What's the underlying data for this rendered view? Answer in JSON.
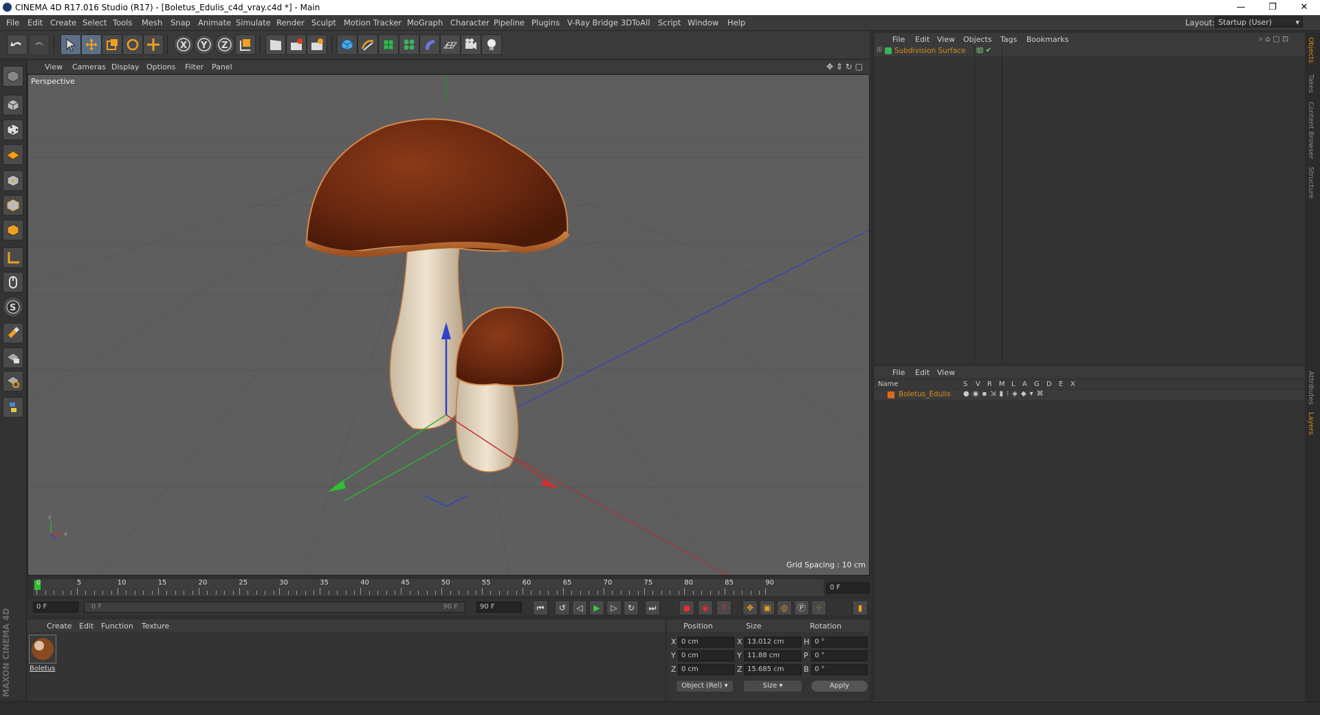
{
  "window": {
    "title": "CINEMA 4D R17.016 Studio (R17) - [Boletus_Edulis_c4d_vray.c4d *] - Main",
    "controls": [
      "—",
      "❐",
      "✕"
    ]
  },
  "menubar": {
    "items": [
      "File",
      "Edit",
      "Create",
      "Select",
      "Tools",
      "Mesh",
      "Snap",
      "Animate",
      "Simulate",
      "Render",
      "Sculpt",
      "Motion Tracker",
      "MoGraph",
      "Character",
      "Pipeline",
      "Plugins",
      "V-Ray Bridge",
      "3DToAll",
      "Script",
      "Window",
      "Help"
    ],
    "layout_label": "Layout:",
    "layout_value": "Startup (User)"
  },
  "viewport": {
    "menu": [
      "View",
      "Cameras",
      "Display",
      "Options",
      "Filter",
      "Panel"
    ],
    "camera_label": "Perspective",
    "grid_spacing": "Grid Spacing : 10 cm"
  },
  "timeline": {
    "ticks": [
      "0",
      "5",
      "10",
      "15",
      "20",
      "25",
      "30",
      "35",
      "40",
      "45",
      "50",
      "55",
      "60",
      "65",
      "70",
      "75",
      "80",
      "85",
      "90"
    ],
    "current_frame": "0 F",
    "start_frame": "0 F",
    "range_start": "0 F",
    "range_end": "90 F",
    "end_frame": "90 F"
  },
  "material_manager": {
    "menu": [
      "Create",
      "Edit",
      "Function",
      "Texture"
    ],
    "materials": [
      {
        "name": "Boletus"
      }
    ],
    "brand": "MAXON CINEMA 4D"
  },
  "coordinates": {
    "headers": [
      "Position",
      "Size",
      "Rotation"
    ],
    "rows": [
      {
        "axis": "X",
        "pos": "0 cm",
        "size_axis": "X",
        "size": "13.012 cm",
        "rot_axis": "H",
        "rot": "0 °"
      },
      {
        "axis": "Y",
        "pos": "0 cm",
        "size_axis": "Y",
        "size": "11.88 cm",
        "rot_axis": "P",
        "rot": "0 °"
      },
      {
        "axis": "Z",
        "pos": "0 cm",
        "size_axis": "Z",
        "size": "15.685 cm",
        "rot_axis": "B",
        "rot": "0 °"
      }
    ],
    "mode_dropdown": "Object (Rel)",
    "size_dropdown": "Size",
    "apply_label": "Apply"
  },
  "object_manager": {
    "menu": [
      "File",
      "Edit",
      "View",
      "Objects",
      "Tags",
      "Bookmarks"
    ],
    "objects": [
      {
        "name": "Subdivision Surface"
      }
    ]
  },
  "layer_manager": {
    "menu": [
      "File",
      "Edit",
      "View"
    ],
    "columns": [
      "Name",
      "S",
      "V",
      "R",
      "M",
      "L",
      "A",
      "G",
      "D",
      "E",
      "X"
    ],
    "layers": [
      {
        "name": "Boletus_Edulis"
      }
    ]
  },
  "right_tabs": [
    "Objects",
    "Takes",
    "Content Browser",
    "Structure",
    "Attributes",
    "Layers"
  ],
  "colors": {
    "accent_orange": "#d88a1a",
    "timeline_marker": "#27c427",
    "axis_x": "#c03030",
    "axis_y": "#30b030",
    "axis_z": "#3040d0"
  }
}
